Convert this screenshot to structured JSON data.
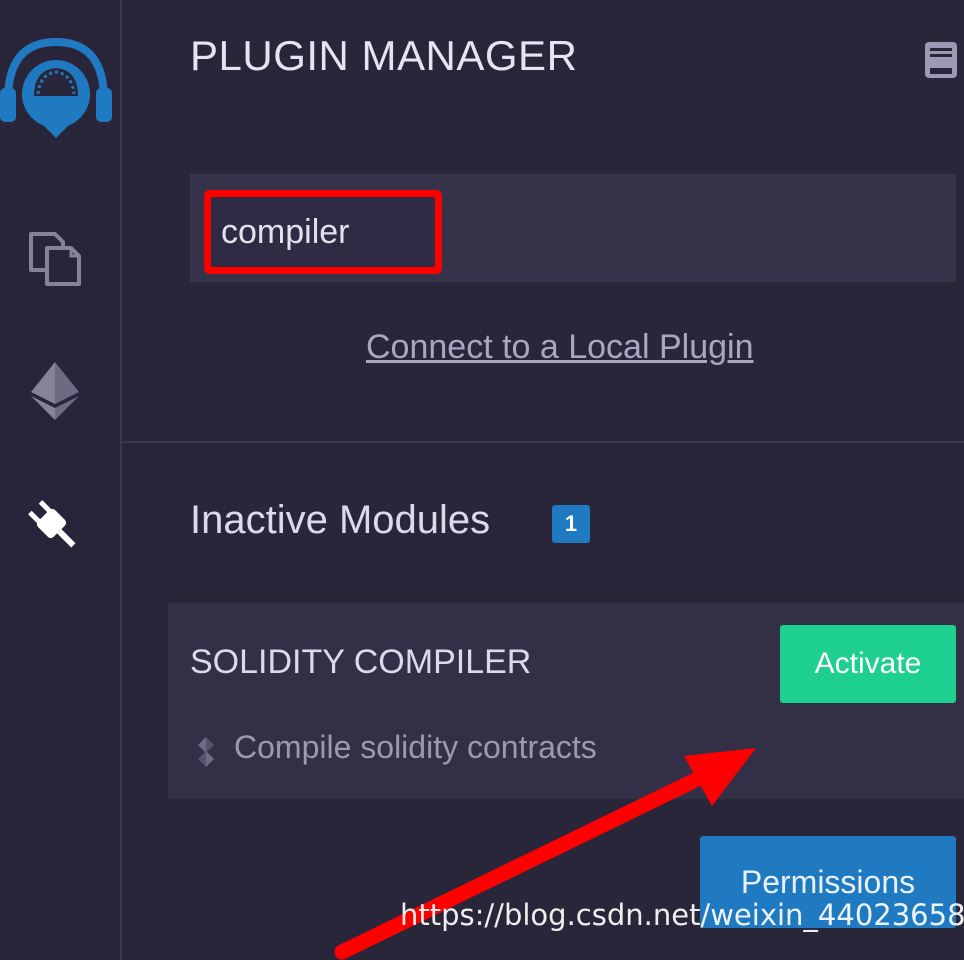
{
  "header": {
    "title": "PLUGIN MANAGER"
  },
  "search": {
    "value": "compiler"
  },
  "local_plugin_link": "Connect to a Local Plugin",
  "inactive_modules": {
    "title": "Inactive Modules",
    "count": "1",
    "items": [
      {
        "name": "SOLIDITY COMPILER",
        "description": "Compile solidity contracts",
        "activate_label": "Activate"
      }
    ]
  },
  "permissions_label": "Permissions",
  "watermark": "https://blog.csdn.net/weixin_44023658",
  "sidebar": {
    "icons": [
      "remix-logo-icon",
      "file-explorer-icon",
      "ethereum-icon",
      "plugin-icon"
    ]
  },
  "colors": {
    "background": "#2a2639",
    "accent_blue": "#1f7ac2",
    "activate_green": "#1ed08f",
    "highlight_red": "#ff0000"
  }
}
